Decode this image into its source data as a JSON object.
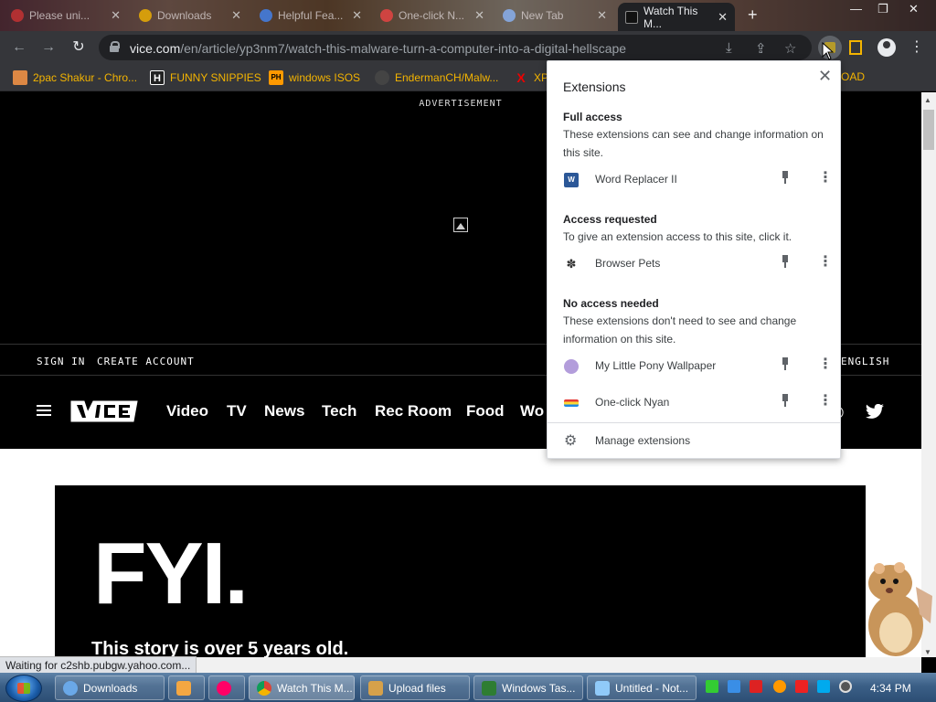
{
  "tabs": [
    {
      "title": "Please uni...",
      "favicon_color": "#c33"
    },
    {
      "title": "Downloads",
      "favicon_color": "#f4b400"
    },
    {
      "title": "Helpful Fea...",
      "favicon_color": "#4285f4"
    },
    {
      "title": "One-click N...",
      "favicon_color": "#e44"
    },
    {
      "title": "New Tab",
      "favicon_color": "#8ab4f8"
    },
    {
      "title": "Watch This M...",
      "favicon_color": "#111",
      "active": true
    }
  ],
  "toolbar": {
    "url_host": "vice.com",
    "url_path": "/en/article/yp3nm7/watch-this-malware-turn-a-computer-into-a-digital-hellscape"
  },
  "bookmarks": [
    {
      "label": "2pac Shakur - Chro...",
      "icon_text": "",
      "icon_color": "#d84"
    },
    {
      "label": "FUNNY SNIPPIES",
      "icon_text": "H",
      "icon_color": "#222"
    },
    {
      "label": "windows ISOS",
      "icon_text": "PH",
      "icon_color": "#f90"
    },
    {
      "label": "EndermanCH/Malw...",
      "icon_text": "",
      "icon_color": "#444"
    },
    {
      "label": "XP",
      "icon_text": "X",
      "icon_color": "#c00"
    },
    {
      "label": "OAD",
      "icon_text": "",
      "icon_color": ""
    }
  ],
  "page": {
    "ad_label": "ADVERTISEMENT",
    "sign_in": "SIGN IN",
    "create_account": "CREATE ACCOUNT",
    "language": "ENGLISH",
    "nav": [
      "Video",
      "TV",
      "News",
      "Tech",
      "Rec Room",
      "Food",
      "Wo"
    ],
    "hero_text": "FYI.",
    "story_text": "This story is over 5 years old."
  },
  "status_bar": "Waiting for c2shb.pubgw.yahoo.com...",
  "extensions_popup": {
    "title": "Extensions",
    "sections": [
      {
        "heading": "Full access",
        "description": "These extensions can see and change information on this site.",
        "items": [
          {
            "name": "Word Replacer II",
            "icon_color": "#2b5797",
            "icon": "word-replacer-icon"
          }
        ]
      },
      {
        "heading": "Access requested",
        "description": "To give an extension access to this site, click it.",
        "items": [
          {
            "name": "Browser Pets",
            "icon_color": "#333",
            "icon": "paw-icon"
          }
        ]
      },
      {
        "heading": "No access needed",
        "description": "These extensions don't need to see and change information on this site.",
        "items": [
          {
            "name": "My Little Pony Wallpaper",
            "icon_color": "#b39ddb",
            "icon": "pony-icon"
          },
          {
            "name": "One-click Nyan",
            "icon_color": "#e57373",
            "icon": "nyan-icon"
          }
        ]
      }
    ],
    "manage_label": "Manage extensions"
  },
  "taskbar": {
    "items": [
      {
        "label": "Downloads",
        "icon_color": "#6aa8e8"
      },
      {
        "label": "",
        "icon_color": "#f4a742"
      },
      {
        "label": "",
        "icon_color": "#f06"
      },
      {
        "label": "Watch This M...",
        "icon_color": "#4285f4",
        "active": true
      },
      {
        "label": "Upload files",
        "icon_color": "#d6a14a"
      },
      {
        "label": "Windows Tas...",
        "icon_color": "#2e7d32"
      },
      {
        "label": "Untitled - Not...",
        "icon_color": "#90caf9"
      }
    ],
    "tray_colors": [
      "#3c3",
      "#3a8ee6",
      "#d22",
      "#f90",
      "#e22",
      "#0ae",
      "#555"
    ],
    "clock": "4:34 PM"
  }
}
